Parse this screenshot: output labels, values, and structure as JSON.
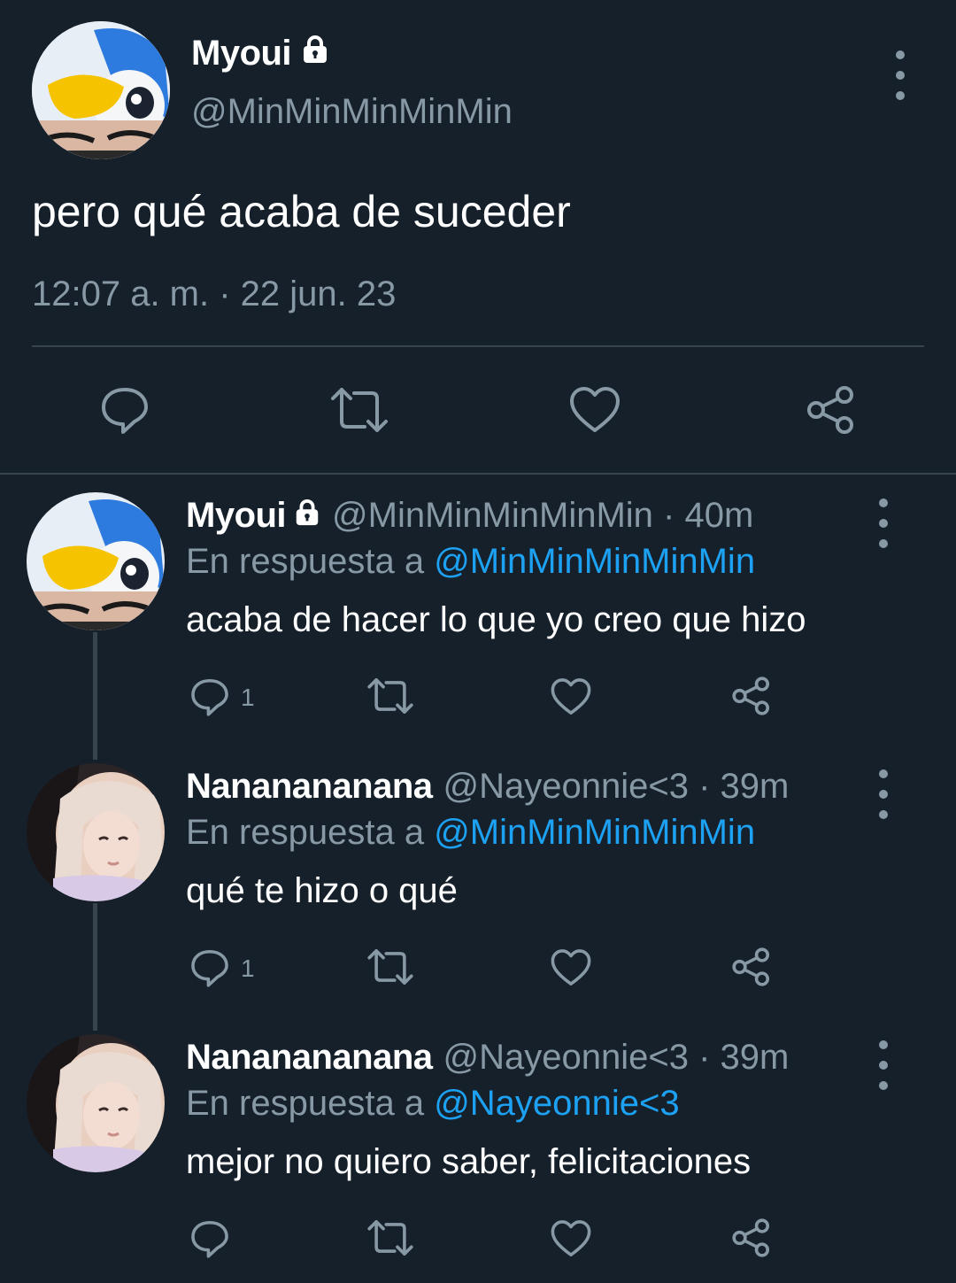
{
  "main_tweet": {
    "display_name": "Myoui",
    "handle": "@MinMinMinMinMin",
    "text": "pero qué acaba de suceder",
    "timestamp": "12:07 a. m. · 22 jun. 23",
    "protected_icon": "lock-icon",
    "actions": [
      "reply-icon",
      "retweet-icon",
      "like-icon",
      "share-icon"
    ]
  },
  "replies": [
    {
      "display_name": "Myoui",
      "meta": "@MinMinMinMinMin · 40m",
      "reply_prefix": "En respuesta a",
      "reply_to": "@MinMinMinMinMin",
      "text": "acaba de hacer lo que yo creo que hizo",
      "reply_count": "1",
      "protected": true
    },
    {
      "display_name": "Nananananana",
      "meta": "@Nayeonnie<3 · 39m",
      "reply_prefix": "En respuesta a",
      "reply_to": "@MinMinMinMinMin",
      "text": "qué te hizo o qué",
      "reply_count": "1",
      "protected": false
    },
    {
      "display_name": "Nananananana",
      "meta": "@Nayeonnie<3 · 39m",
      "reply_prefix": "En respuesta a",
      "reply_to": "@Nayeonnie<3",
      "text": "mejor no quiero saber, felicitaciones",
      "reply_count": "",
      "protected": false
    }
  ],
  "colors": {
    "background": "#15202b",
    "secondary_text": "#8899a6",
    "mention": "#1da1f2",
    "divider": "#38444d"
  }
}
